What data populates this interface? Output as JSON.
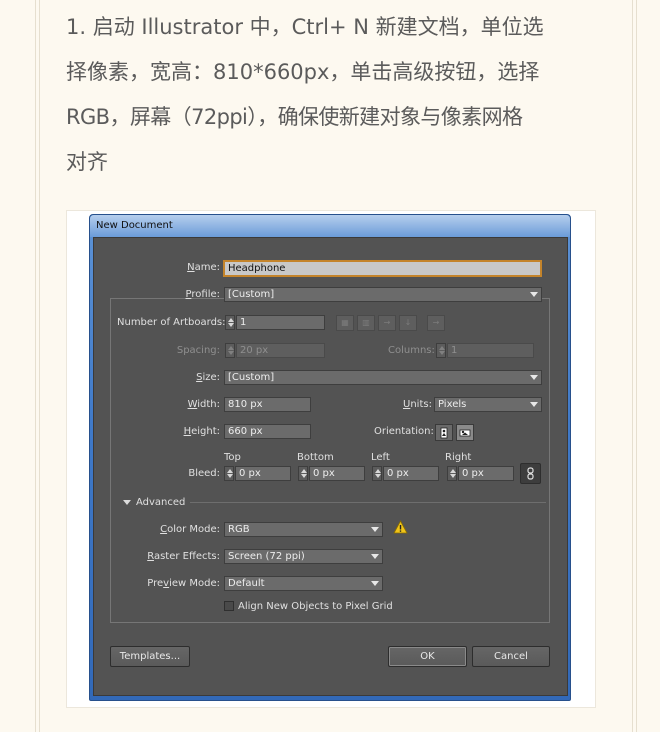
{
  "intro": {
    "line1": "1. 启动 Illustrator 中，Ctrl+ N 新建文档，单位选",
    "line2": "择像素，宽高：810*660px，单击高级按钮，选择",
    "line3": "RGB，屏幕（72ppi），确保使新建对象与像素网格",
    "line4": "对齐"
  },
  "dialog": {
    "title": "New Document",
    "name_label": "Name:",
    "name_value": "Headphone",
    "profile_label": "Profile:",
    "profile_value": "[Custom]",
    "artboards_label": "Number of Artboards:",
    "artboards_value": "1",
    "spacing_label": "Spacing:",
    "spacing_value": "20 px",
    "columns_label": "Columns:",
    "columns_value": "1",
    "size_label": "Size:",
    "size_value": "[Custom]",
    "width_label": "Width:",
    "width_value": "810 px",
    "units_label": "Units:",
    "units_value": "Pixels",
    "height_label": "Height:",
    "height_value": "660 px",
    "orientation_label": "Orientation:",
    "bleed_label": "Bleed:",
    "bleed_top_label": "Top",
    "bleed_bottom_label": "Bottom",
    "bleed_left_label": "Left",
    "bleed_right_label": "Right",
    "bleed_top_value": "0 px",
    "bleed_bottom_value": "0 px",
    "bleed_left_value": "0 px",
    "bleed_right_value": "0 px",
    "advanced_label": "Advanced",
    "color_mode_label": "Color Mode:",
    "color_mode_value": "RGB",
    "raster_label": "Raster Effects:",
    "raster_value": "Screen (72 ppi)",
    "preview_label": "Preview Mode:",
    "preview_value": "Default",
    "align_label": "Align New Objects to Pixel Grid",
    "templates_button": "Templates...",
    "ok_button": "OK",
    "cancel_button": "Cancel"
  },
  "colors": {
    "page_background": "#fdf9f0",
    "dialog_background": "#535353",
    "name_field_highlight": "#c4842b",
    "window_chrome": "#3f79c8",
    "warning": "#f0c419"
  },
  "icons": [
    "artboard-grid-by-row-icon",
    "artboard-grid-by-column-icon",
    "artboard-arrange-by-row-icon",
    "artboard-arrange-by-column-icon",
    "artboard-layout-direction-icon",
    "portrait-orientation-icon",
    "landscape-orientation-icon",
    "link-bleed-icon",
    "warning-icon"
  ]
}
